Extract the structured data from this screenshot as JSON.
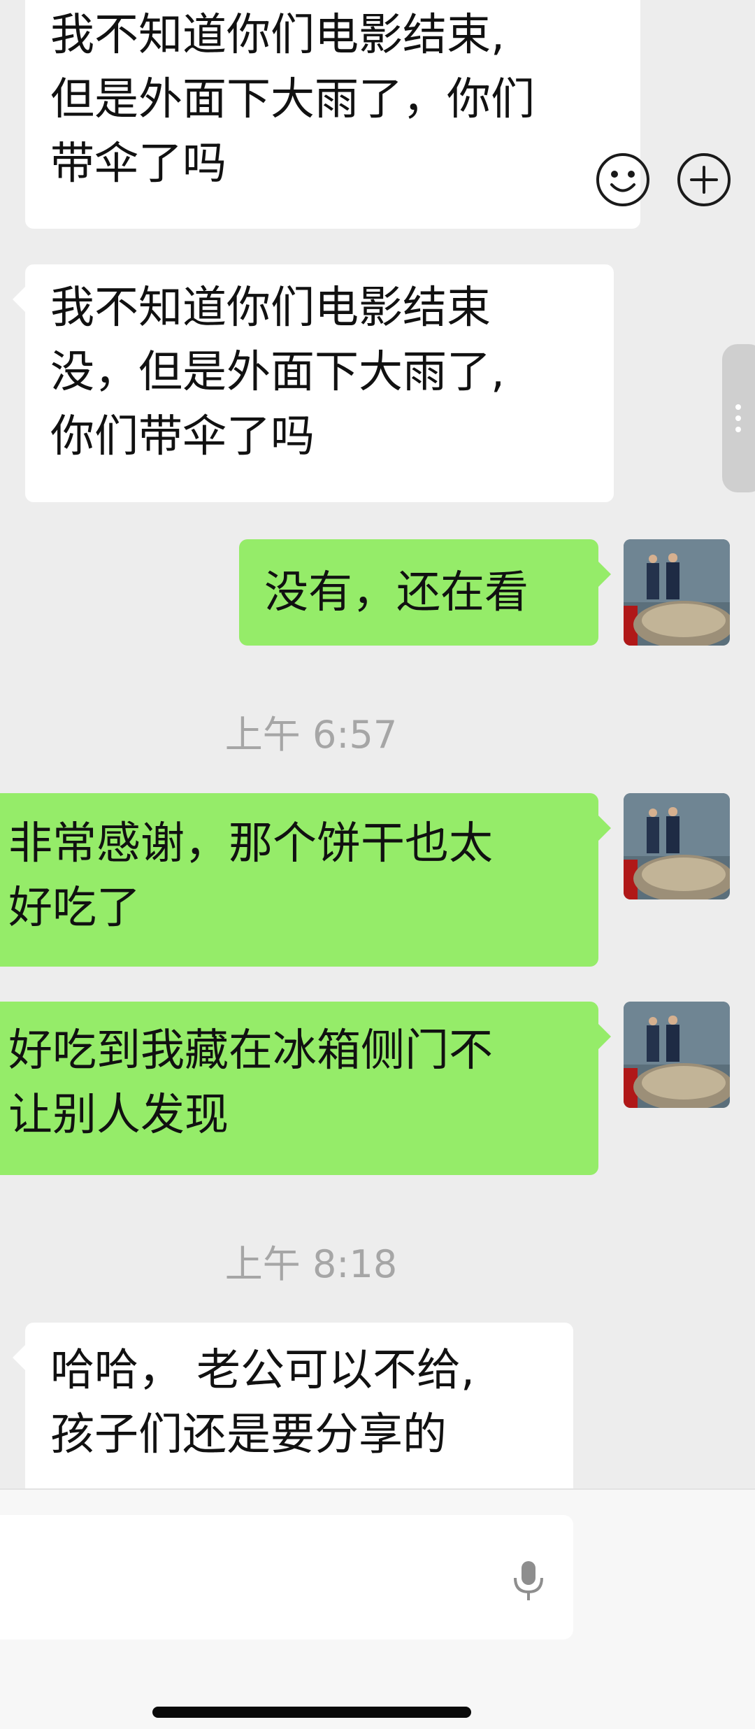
{
  "messages": [
    {
      "side": "in",
      "lines": [
        "我不知道你们电影结束,",
        "但是外面下大雨了，你们",
        "带伞了吗"
      ]
    },
    {
      "side": "in",
      "lines": [
        "我不知道你们电影结束",
        "没，但是外面下大雨了,",
        "你们带伞了吗"
      ]
    },
    {
      "side": "out",
      "lines": [
        "没有，还在看"
      ]
    },
    {
      "timestamp": "上午 6:57"
    },
    {
      "side": "out",
      "lines": [
        "非常感谢，那个饼干也太",
        "好吃了"
      ]
    },
    {
      "side": "out",
      "lines": [
        "好吃到我藏在冰箱侧门不",
        "让别人发现"
      ]
    },
    {
      "timestamp": "上午 8:18"
    },
    {
      "side": "in",
      "lines": [
        "哈哈， 老公可以不给,",
        "孩子们还是要分享的"
      ]
    }
  ],
  "input_bar": {
    "message_value": "",
    "mic_icon": "microphone-icon",
    "emoji_icon": "smiley-face-icon",
    "more_icon": "plus-circle-icon"
  },
  "colors": {
    "background": "#ededed",
    "incoming_bubble": "#ffffff",
    "outgoing_bubble": "#95ec69",
    "timestamp_text": "#a6a6a6"
  }
}
